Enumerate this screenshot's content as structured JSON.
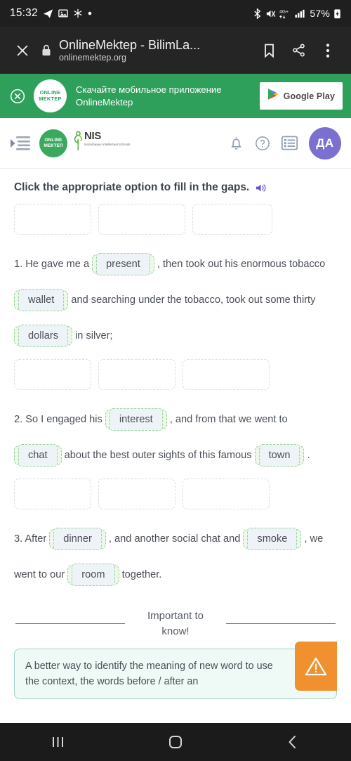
{
  "status_bar": {
    "time": "15:32",
    "left_icons": [
      "telegram-icon",
      "image-icon",
      "snowflake-icon",
      "dot-icon"
    ],
    "right_icons": [
      "bluetooth-icon",
      "mute-icon",
      "4g-plus-icon",
      "signal-icon"
    ],
    "battery_percent": "57%"
  },
  "browser_bar": {
    "close_icon": "close-icon",
    "lock_icon": "lock-icon",
    "title": "OnlineMektep - BilimLa...",
    "url": "onlinemektep.org",
    "bookmark_icon": "bookmark-icon",
    "share_icon": "share-icon",
    "menu_icon": "overflow-menu-icon"
  },
  "promo_banner": {
    "close_icon": "close-circle-icon",
    "logo_line1": "ONLINE",
    "logo_line2": "MEKTEP",
    "text": "Скачайте мобильное приложение OnlineMektep",
    "button_label": "Google Play",
    "background_color": "#2fa05b"
  },
  "site_header": {
    "menu_icon": "sidebar-toggle-icon",
    "logo_line1": "ONLINE",
    "logo_line2": "МЕКТЕП",
    "nis_name": "NIS",
    "nis_subtitle": "Nazarbayev Intellectual Schools",
    "notifications_icon": "bell-icon",
    "help_icon": "question-circle-icon",
    "list_icon": "list-icon",
    "avatar_initials": "ДА",
    "avatar_color": "#7b6fd0"
  },
  "task": {
    "title": "Click the appropriate option to fill in the gaps.",
    "audio_icon": "speaker-icon"
  },
  "blocks": [
    {
      "dropzones": [
        "",
        "",
        ""
      ],
      "number": "1.",
      "parts": [
        {
          "type": "text",
          "value": "1. He gave me a "
        },
        {
          "type": "chip",
          "value": "present"
        },
        {
          "type": "text",
          "value": " , then took out his enormous tobacco "
        },
        {
          "type": "chip",
          "value": "wallet"
        },
        {
          "type": "text",
          "value": " and searching under the tobacco, took out some thirty "
        },
        {
          "type": "chip",
          "value": "dollars"
        },
        {
          "type": "text",
          "value": " in silver;"
        }
      ]
    },
    {
      "dropzones": [
        "",
        "",
        ""
      ],
      "number": "2.",
      "parts": [
        {
          "type": "text",
          "value": "2. So I engaged his "
        },
        {
          "type": "chip",
          "value": "interest"
        },
        {
          "type": "text",
          "value": " , and from that we went to "
        },
        {
          "type": "chip",
          "value": "chat"
        },
        {
          "type": "text",
          "value": " about the best outer sights of this famous "
        },
        {
          "type": "chip",
          "value": "town"
        },
        {
          "type": "text",
          "value": " ."
        }
      ]
    },
    {
      "dropzones": [
        "",
        "",
        ""
      ],
      "number": "3.",
      "parts": [
        {
          "type": "text",
          "value": "3. After "
        },
        {
          "type": "chip",
          "value": "dinner"
        },
        {
          "type": "text",
          "value": " , and another social chat and "
        },
        {
          "type": "chip",
          "value": "smoke"
        },
        {
          "type": "text",
          "value": " , we went to our "
        },
        {
          "type": "chip",
          "value": "room"
        },
        {
          "type": "text",
          "value": " together."
        }
      ]
    }
  ],
  "important_section": {
    "label": "Important to know!",
    "info_text": "A better way to identify the meaning of new word to use the context, the words before / after an",
    "badge_icon": "warning-triangle-icon",
    "badge_color": "#f0902f"
  },
  "nav_bar": {
    "recents_icon": "recents-icon",
    "home_icon": "home-icon",
    "back_icon": "back-icon"
  }
}
